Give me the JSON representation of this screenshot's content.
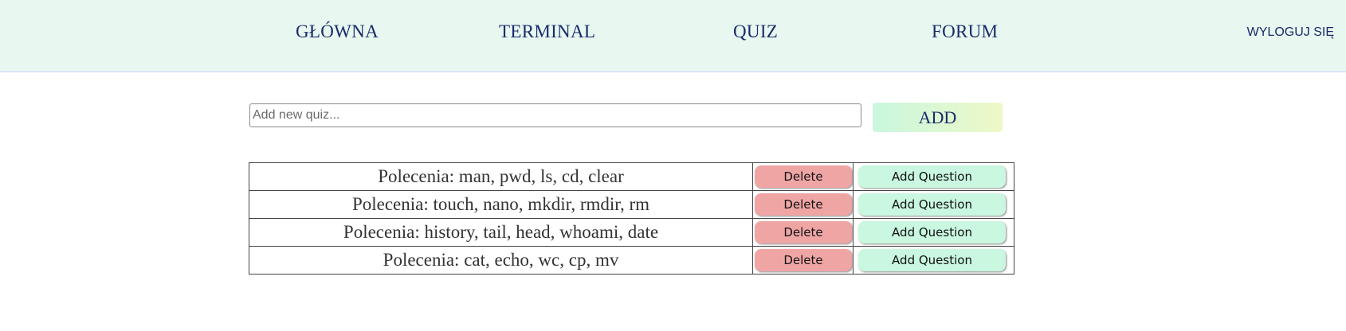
{
  "nav": {
    "links": [
      "GŁÓWNA",
      "TERMINAL",
      "QUIZ",
      "FORUM"
    ],
    "logout": "WYLOGUJ SIĘ"
  },
  "add_quiz": {
    "placeholder": "Add new quiz...",
    "value": "",
    "button_label": "ADD"
  },
  "quizzes": [
    {
      "name": "Polecenia: man, pwd, ls, cd, clear",
      "delete_label": "Delete",
      "add_question_label": "Add Question"
    },
    {
      "name": "Polecenia: touch, nano, mkdir, rmdir, rm",
      "delete_label": "Delete",
      "add_question_label": "Add Question"
    },
    {
      "name": "Polecenia: history, tail, head, whoami, date",
      "delete_label": "Delete",
      "add_question_label": "Add Question"
    },
    {
      "name": "Polecenia: cat, echo, wc, cp, mv",
      "delete_label": "Delete",
      "add_question_label": "Add Question"
    }
  ],
  "colors": {
    "nav_background": "#e8f8f0",
    "nav_text": "#1a2a6c",
    "delete_button": "#f0a5a5",
    "add_question_button": "#c9f7df",
    "add_button_gradient_start": "#c9f7df",
    "add_button_gradient_end": "#eef8c6"
  }
}
